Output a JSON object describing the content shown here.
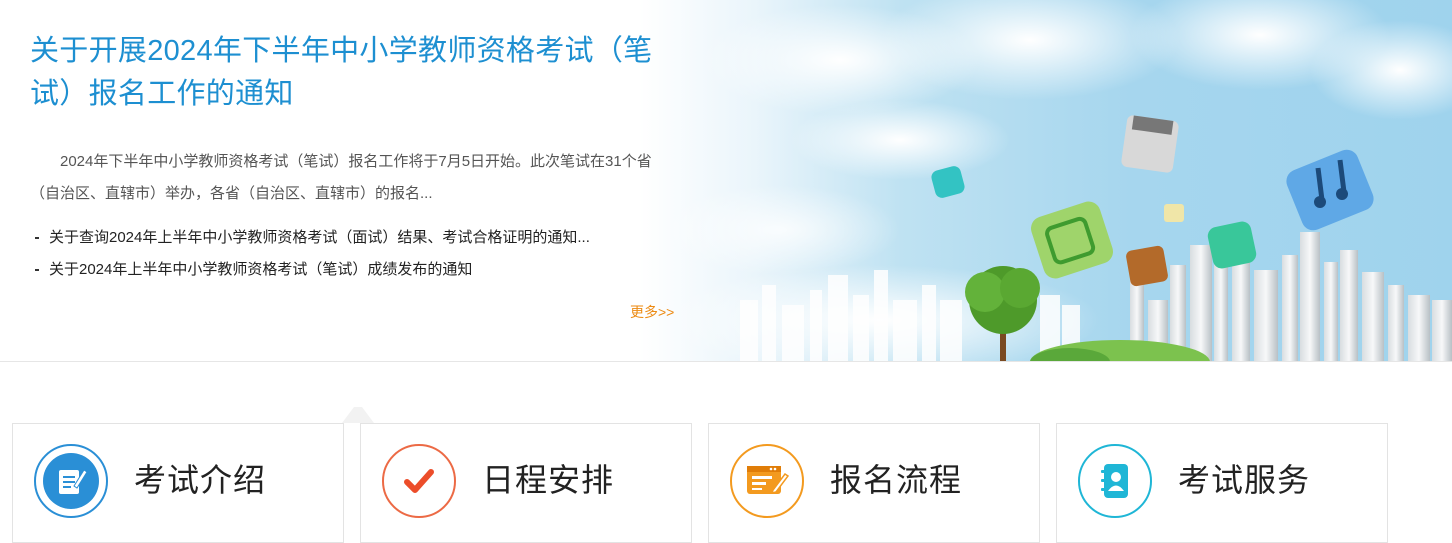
{
  "banner": {
    "title": "关于开展2024年下半年中小学教师资格考试（笔试）报名工作的通知",
    "summary": "2024年下半年中小学教师资格考试（笔试）报名工作将于7月5日开始。此次笔试在31个省（自治区、直辖市）举办，各省（自治区、直辖市）的报名...",
    "news_items": [
      "关于查询2024年上半年中小学教师资格考试（面试）结果、考试合格证明的通知...",
      "关于2024年上半年中小学教师资格考试（笔试）成绩发布的通知"
    ],
    "more_label": "更多>>"
  },
  "cards": [
    {
      "label": "考试介绍",
      "icon": "document-edit-icon",
      "color": "#2a8fd6"
    },
    {
      "label": "日程安排",
      "icon": "checkmark-icon",
      "color": "#ec6a45"
    },
    {
      "label": "报名流程",
      "icon": "form-edit-icon",
      "color": "#f39a1f"
    },
    {
      "label": "考试服务",
      "icon": "contact-book-icon",
      "color": "#1fb6d6"
    }
  ],
  "colors": {
    "title_blue": "#1d8fd1",
    "more_orange": "#ec8a12",
    "sky_blue": "#9fd3ed"
  }
}
